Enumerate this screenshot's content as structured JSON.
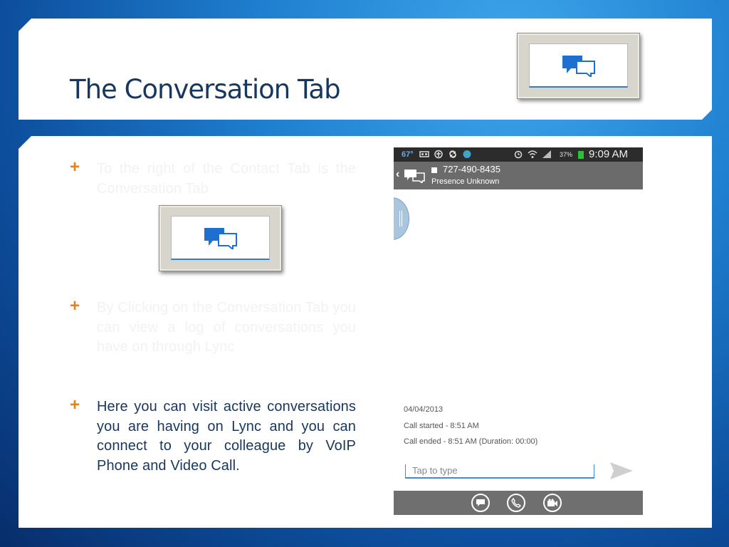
{
  "slide": {
    "title": "The Conversation Tab",
    "bullets": [
      {
        "text": "To the right of the Contact Tab is the Conversation Tab"
      },
      {
        "text": "By Clicking on the Conversation Tab you can view a log of conversations you have on through Lync"
      },
      {
        "text": "Here you can visit active conversations you are having on Lync and you can connect to your colleague by VoIP Phone and Video Call."
      }
    ]
  },
  "phone": {
    "status": {
      "temperature": "67°",
      "battery": "37%",
      "time": "9:09 AM"
    },
    "contact": {
      "number": "727-490-8435",
      "presence": "Presence Unknown"
    },
    "log": {
      "date": "04/04/2013",
      "started": "Call started - 8:51 AM",
      "ended": "Call ended - 8:51 AM (Duration: 00:00)"
    },
    "input_placeholder": "Tap to type"
  },
  "colors": {
    "title": "#17375e",
    "bullet_marker": "#e3821e",
    "tab_accent": "#2b7fd8"
  }
}
